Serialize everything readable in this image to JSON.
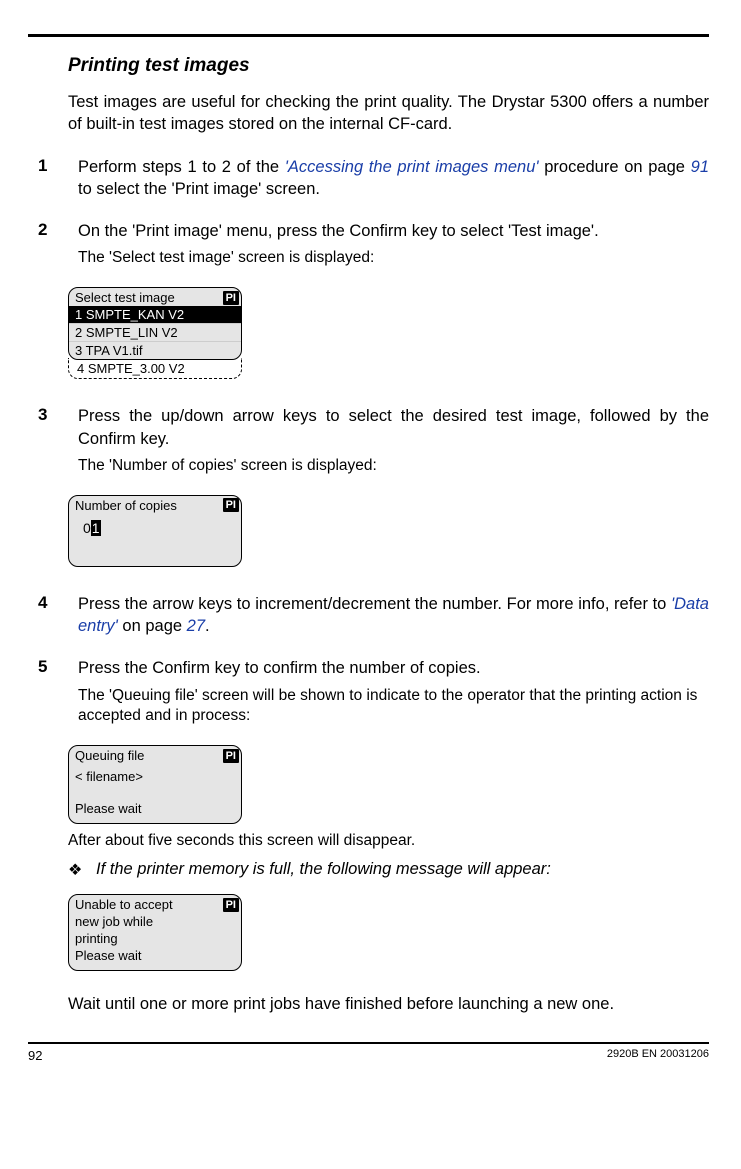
{
  "heading": "Printing test images",
  "intro": "Test images are useful for checking the print quality. The Drystar 5300 offers a number of built-in test images stored on the internal CF-card.",
  "steps": {
    "s1": {
      "num": "1",
      "prefix": "Perform steps 1 to 2 of the ",
      "link": "'Accessing the print images menu'",
      "mid": " procedure on page ",
      "pageref": "91",
      "suffix": " to select the 'Print image' screen."
    },
    "s2": {
      "num": "2",
      "text": "On the 'Print image' menu, press the Confirm key to select 'Test image'.",
      "sub": "The 'Select test image' screen is displayed:"
    },
    "s3": {
      "num": "3",
      "text": "Press the up/down arrow keys to select the desired test image, followed by the Confirm key.",
      "sub": "The 'Number of copies' screen is displayed:"
    },
    "s4": {
      "num": "4",
      "prefix": "Press the arrow keys to increment/decrement the number. For more info, refer to ",
      "link": "'Data entry'",
      "mid": " on page ",
      "pageref": "27",
      "suffix": "."
    },
    "s5": {
      "num": "5",
      "text": "Press the Confirm key to confirm the number of copies.",
      "sub": "The 'Queuing file' screen will be shown to indicate to the operator that the printing action is accepted and in process:"
    }
  },
  "lcd1": {
    "title": "Select test image",
    "badge": "PI",
    "rows": {
      "r1": "1 SMPTE_KAN V2",
      "r2": "2 SMPTE_LIN V2",
      "r3": "3 TPA V1.tif"
    },
    "extra": "4 SMPTE_3.00 V2"
  },
  "lcd2": {
    "title": "Number of copies",
    "badge": "PI",
    "val_pre": "0",
    "val_hl": "1"
  },
  "lcd3": {
    "title": "Queuing file",
    "badge": "PI",
    "line2": "<   filename>",
    "line4": "Please wait"
  },
  "after3": "After about five seconds this screen will disappear.",
  "note": "If the printer memory is full, the following message will appear:",
  "lcd4": {
    "title": "Unable to accept",
    "badge": "PI",
    "line2": "new job while",
    "line3": "printing",
    "line4": "Please wait"
  },
  "closing": "Wait until one or more print jobs have finished before launching a new one.",
  "footer": {
    "page": "92",
    "doc": "2920B EN 20031206"
  }
}
